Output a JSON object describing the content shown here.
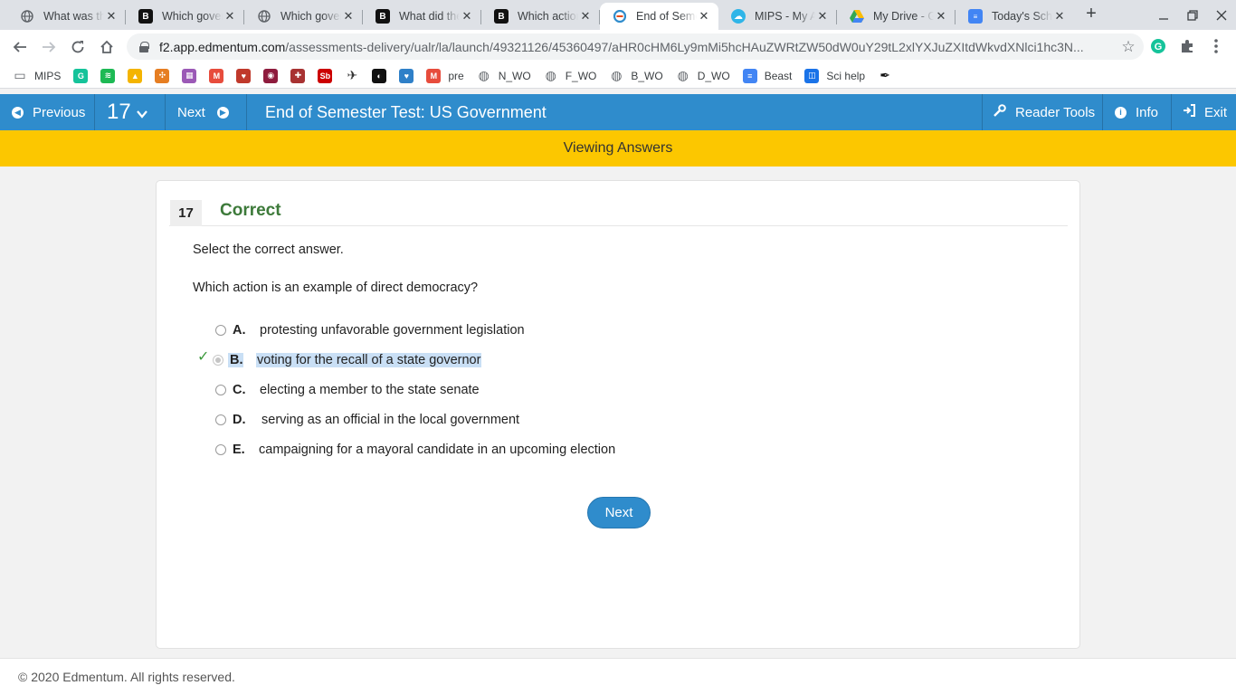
{
  "browser": {
    "tabs": [
      {
        "title": "What was th",
        "icon": "globe-icon",
        "active": false
      },
      {
        "title": "Which gover",
        "icon": "b-icon",
        "active": false
      },
      {
        "title": "Which gover",
        "icon": "globe-icon",
        "active": false
      },
      {
        "title": "What did the",
        "icon": "b-icon",
        "active": false
      },
      {
        "title": "Which action",
        "icon": "b-icon",
        "active": false
      },
      {
        "title": "End of Seme",
        "icon": "edmentum-icon",
        "active": true
      },
      {
        "title": "MIPS - My A",
        "icon": "cloud-icon",
        "active": false
      },
      {
        "title": "My Drive - G",
        "icon": "google-drive-icon",
        "active": false
      },
      {
        "title": "Today's Sch",
        "icon": "google-docs-icon",
        "active": false
      }
    ],
    "url_host": "f2.app.edmentum.com",
    "url_path": "/assessments-delivery/ualr/la/launch/49321126/45360497/aHR0cHM6Ly9mMi5hcHAuZWRtZW50dW0uY29tL2xlYXJuZXItdWkvdXNlci1hc3N...",
    "bookmarks": [
      {
        "label": "MIPS",
        "icon": "folder-icon",
        "color": "#5f6368"
      },
      {
        "label": "",
        "icon": "grammarly-icon",
        "color": "#15c39a"
      },
      {
        "label": "",
        "icon": "spotify-icon",
        "color": "#1db954"
      },
      {
        "label": "",
        "icon": "google-drive-icon",
        "color": "#f4b400"
      },
      {
        "label": "",
        "icon": "pinwheel-icon",
        "color": "#e67e22"
      },
      {
        "label": "",
        "icon": "colorful-grid-icon",
        "color": "#9b59b6"
      },
      {
        "label": "",
        "icon": "m-icon",
        "color": "#e74c3c"
      },
      {
        "label": "",
        "icon": "heart-icon",
        "color": "#c0392b"
      },
      {
        "label": "",
        "icon": "circle-logo-icon",
        "color": "#8e1b3d"
      },
      {
        "label": "",
        "icon": "bookmark-icon",
        "color": "#a83232"
      },
      {
        "label": "",
        "icon": "sb-icon",
        "color": "#cc0000"
      },
      {
        "label": "",
        "icon": "bird-icon",
        "color": "#333333"
      },
      {
        "label": "",
        "icon": "swirl-icon",
        "color": "#111111"
      },
      {
        "label": "",
        "icon": "heart-box-icon",
        "color": "#2f80c8"
      },
      {
        "label": "pre",
        "icon": "m-icon",
        "color": "#e74c3c"
      },
      {
        "label": "N_WO",
        "icon": "globe-icon",
        "color": "#5f6368"
      },
      {
        "label": "F_WO",
        "icon": "globe-icon",
        "color": "#5f6368"
      },
      {
        "label": "B_WO",
        "icon": "globe-icon",
        "color": "#5f6368"
      },
      {
        "label": "D_WO",
        "icon": "globe-icon",
        "color": "#5f6368"
      },
      {
        "label": "Beast",
        "icon": "docs-icon",
        "color": "#4285f4"
      },
      {
        "label": "Sci help",
        "icon": "layout-icon",
        "color": "#1a73e8"
      },
      {
        "label": "",
        "icon": "feather-icon",
        "color": "#111111"
      }
    ]
  },
  "app": {
    "prev_label": "Previous",
    "question_number": "17",
    "next_label": "Next",
    "title": "End of Semester Test: US Government",
    "reader_tools_label": "Reader Tools",
    "info_label": "Info",
    "exit_label": "Exit",
    "banner": "Viewing Answers",
    "accent_color": "#2f8ccc",
    "banner_color": "#fcc700"
  },
  "question": {
    "number": "17",
    "status": "Correct",
    "instruction": "Select the correct answer.",
    "prompt": "Which action is an example of direct democracy?",
    "options": [
      {
        "letter": "A.",
        "text": "protesting unfavorable government legislation"
      },
      {
        "letter": "B.",
        "text": "voting for the recall of a state governor"
      },
      {
        "letter": "C.",
        "text": "electing a member to the state senate"
      },
      {
        "letter": "D.",
        "text": "serving as an official in the local government"
      },
      {
        "letter": "E.",
        "text": "campaigning for a mayoral candidate in an upcoming election"
      }
    ],
    "next_button": "Next"
  },
  "footer": {
    "copyright": "© 2020 Edmentum. All rights reserved."
  }
}
